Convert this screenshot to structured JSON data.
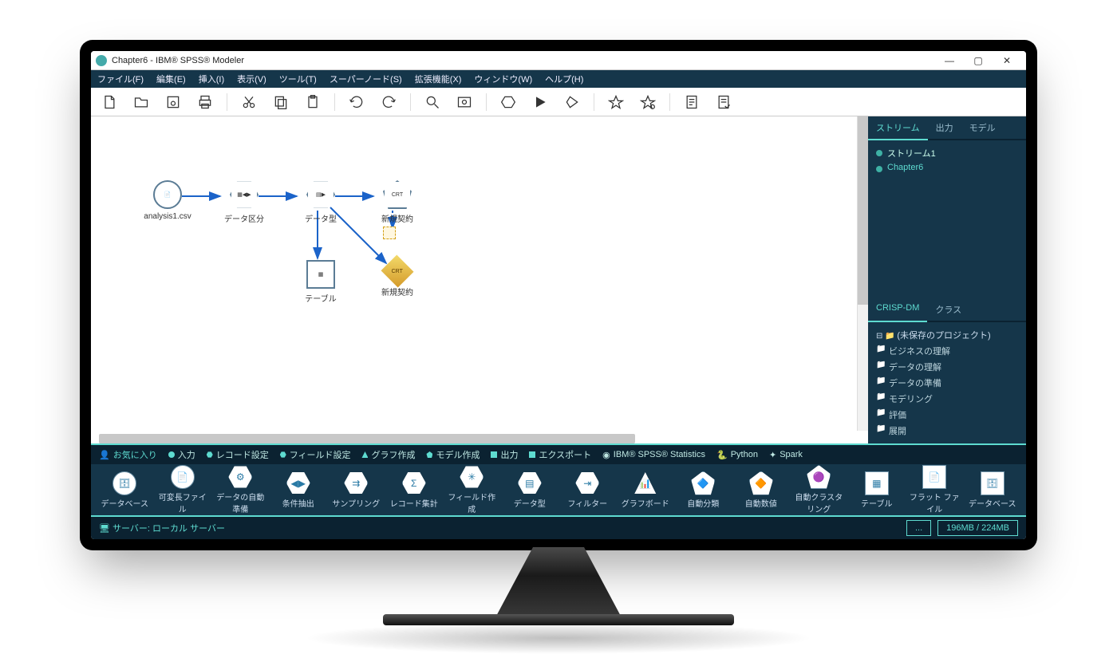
{
  "window": {
    "title": "Chapter6 - IBM® SPSS® Modeler"
  },
  "menu": {
    "file": "ファイル(F)",
    "edit": "編集(E)",
    "insert": "挿入(I)",
    "view": "表示(V)",
    "tools": "ツール(T)",
    "supernode": "スーパーノード(S)",
    "extensions": "拡張機能(X)",
    "window": "ウィンドウ(W)",
    "help": "ヘルプ(H)"
  },
  "canvas": {
    "nodes": {
      "source": "analysis1.csv",
      "partition": "データ区分",
      "type": "データ型",
      "crt_model": "新規契約",
      "table": "テーブル",
      "crt_nugget": "新規契約",
      "crt_label": "CRT"
    }
  },
  "right": {
    "tabs": {
      "streams": "ストリーム",
      "output": "出力",
      "models": "モデル"
    },
    "tree": {
      "item1": "ストリーム1",
      "item2": "Chapter6"
    },
    "crisp": {
      "tab1": "CRISP-DM",
      "tab2": "クラス",
      "root": "(未保存のプロジェクト)",
      "p1": "ビジネスの理解",
      "p2": "データの理解",
      "p3": "データの準備",
      "p4": "モデリング",
      "p5": "評価",
      "p6": "展開"
    }
  },
  "palettecats": {
    "fav": "お気に入り",
    "input": "入力",
    "record": "レコード設定",
    "field": "フィールド設定",
    "graph": "グラフ作成",
    "model": "モデル作成",
    "output": "出力",
    "export": "エクスポート",
    "stats": "IBM® SPSS® Statistics",
    "python": "Python",
    "spark": "Spark"
  },
  "palette": {
    "p1": "データベース",
    "p2": "可変長ファイル",
    "p3": "データの自動準備",
    "p4": "条件抽出",
    "p5": "サンプリング",
    "p6": "レコード集計",
    "p7": "フィールド作成",
    "p8": "データ型",
    "p9": "フィルター",
    "p10": "グラフボード",
    "p11": "自動分類",
    "p12": "自動数値",
    "p13": "自動クラスタリング",
    "p14": "テーブル",
    "p15": "フラット ファイル",
    "p16": "データベース"
  },
  "status": {
    "server": "サーバー: ローカル サーバー",
    "ellipsis": "...",
    "memory": "196MB / 224MB"
  }
}
